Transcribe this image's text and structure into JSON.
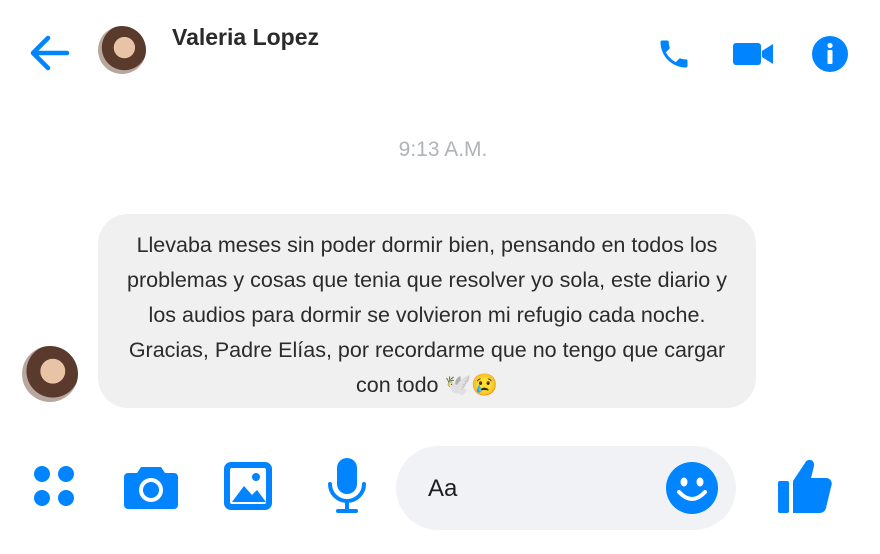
{
  "header": {
    "contact_name": "Valeria Lopez",
    "back_icon": "arrow-left-icon",
    "call_icon": "phone-icon",
    "video_icon": "video-camera-icon",
    "info_icon": "info-icon"
  },
  "conversation": {
    "timestamp": "9:13 A.M.",
    "messages": [
      {
        "sender": "Valeria Lopez",
        "text": "Llevaba meses sin poder dormir bien, pensando en todos los problemas y cosas que tenia que resolver yo sola, este diario y los audios para dormir se volvieron mi refugio cada noche. Gracias, Padre Elías, por recordarme que no tengo que cargar con todo 🕊️😢"
      }
    ]
  },
  "composer": {
    "placeholder": "Aa",
    "icons": [
      "apps-grid-icon",
      "camera-icon",
      "image-icon",
      "microphone-icon",
      "emoji-icon",
      "thumbs-up-icon"
    ]
  },
  "colors": {
    "accent": "#0084ff",
    "bubble": "#f0f0f0",
    "composer": "#f0f2f5",
    "timestamp": "#b0b3b8"
  }
}
